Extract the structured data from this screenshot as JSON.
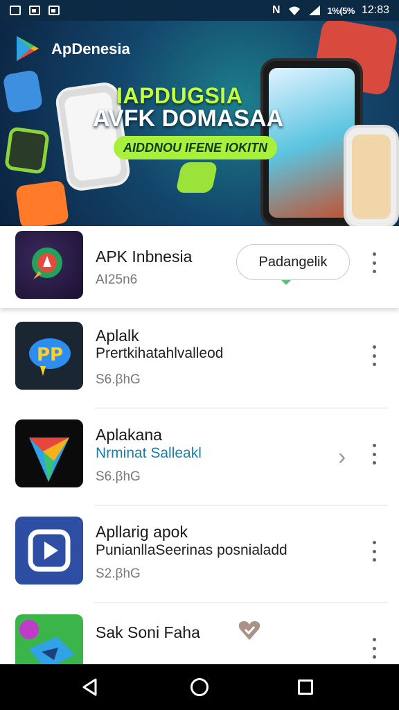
{
  "status_bar": {
    "left_icons": [
      "notification-icon",
      "gallery-icon",
      "message-icon"
    ],
    "right_glyph": "N",
    "battery_text": "1%(5%",
    "time": "12:83"
  },
  "banner": {
    "app_name": "ApDenesia",
    "headline_line1": "IAPDUGSIA",
    "headline_line2": "AVFK DOMASAA",
    "pill_text": "AIDDNOU IFENE IOKITN"
  },
  "featured": {
    "title": "APK Inbnesia",
    "subtitle": "AI25n6",
    "button_label": "Padangelik"
  },
  "apps": [
    {
      "title": "Aplalk",
      "subtitle": "Prertkihatahlvalleod",
      "meta": "S6.βhG"
    },
    {
      "title": "Aplakana",
      "subtitle": "Nrminat Salleakl",
      "meta": "S6.βhG"
    },
    {
      "title": "Apllarig apok",
      "subtitle": "PunianllaSeerinas posnialadd",
      "meta": "S2.βhG"
    },
    {
      "title": "Sak Soni Faha",
      "subtitle": "",
      "meta": ""
    }
  ],
  "colors": {
    "status_bg": "#0d2a45",
    "accent_green": "#a8f03a",
    "subtitle_blue": "#1a7fa8"
  }
}
